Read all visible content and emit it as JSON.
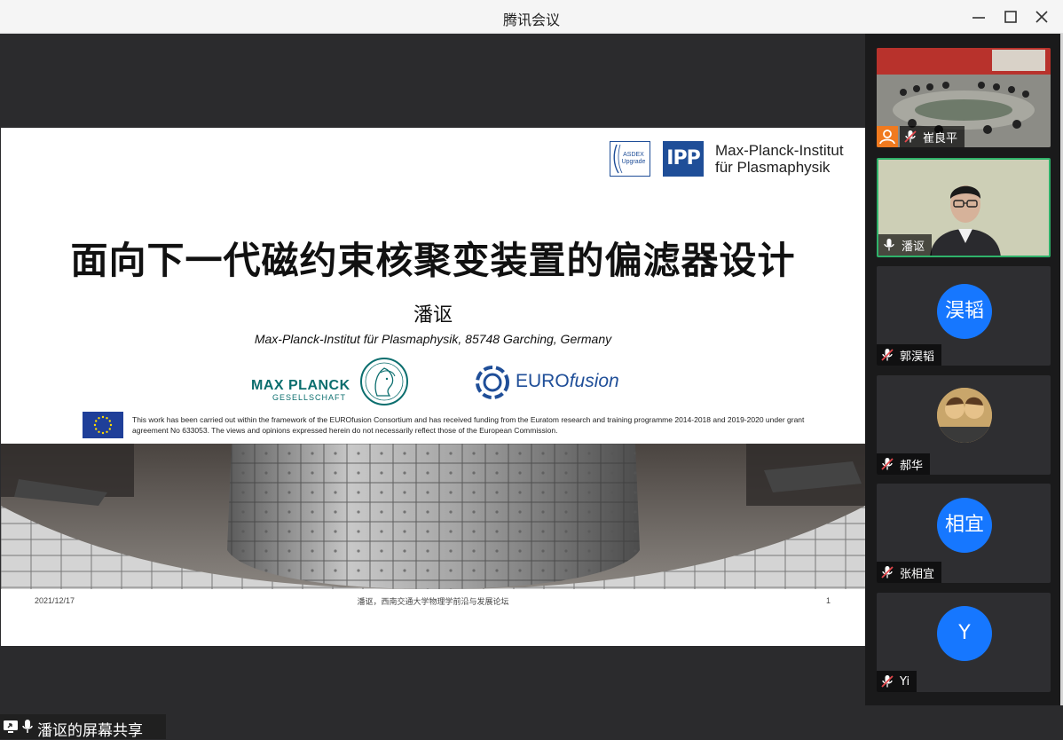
{
  "window": {
    "title": "腾讯会议"
  },
  "slide": {
    "ipp_name_line1": "Max-Planck-Institut",
    "ipp_name_line2": "für Plasmaphysik",
    "ipp_abbrev": "IPP",
    "asdex_label_1": "ASDEX",
    "asdex_label_2": "Upgrade",
    "title": "面向下一代磁约束核聚变装置的偏滤器设计",
    "author": "潘讴",
    "affiliation": "Max-Planck-Institut für Plasmaphysik, 85748 Garching, Germany",
    "mpg_line1": "MAX PLANCK",
    "mpg_line2": "GESELLSCHAFT",
    "eurofusion_prefix": "EURO",
    "eurofusion_suffix": "fusion",
    "disclaimer": "This work has been carried out within the framework of the EUROfusion Consortium and has received funding from the Euratom research and training programme 2014-2018 and 2019-2020 under grant agreement No 633053. The views and opinions expressed herein do not necessarily reflect those of the European Commission.",
    "footer_date": "2021/12/17",
    "footer_center": "潘讴，西南交通大学物理学前沿与发展论坛",
    "footer_page": "1"
  },
  "share_bar": {
    "label": "潘讴的屏幕共享"
  },
  "participants": [
    {
      "name": "崔良平",
      "type": "video-room",
      "muted": true
    },
    {
      "name": "潘讴",
      "type": "video-person",
      "muted": false,
      "active": true
    },
    {
      "name": "郭淏韬",
      "type": "avatar",
      "avatar_text": "淏韬",
      "muted": true
    },
    {
      "name": "郝华",
      "type": "photo-avatar",
      "muted": true
    },
    {
      "name": "张相宜",
      "type": "avatar",
      "avatar_text": "相宜",
      "muted": true
    },
    {
      "name": "Yi",
      "type": "avatar",
      "avatar_text": "Y",
      "muted": true
    }
  ],
  "colors": {
    "avatar_blue": "#1677ff",
    "active_border": "#2fb26a",
    "mute_red": "#e5484d",
    "ipp_blue": "#1f4e98",
    "mpg_teal": "#0b6e6e"
  }
}
